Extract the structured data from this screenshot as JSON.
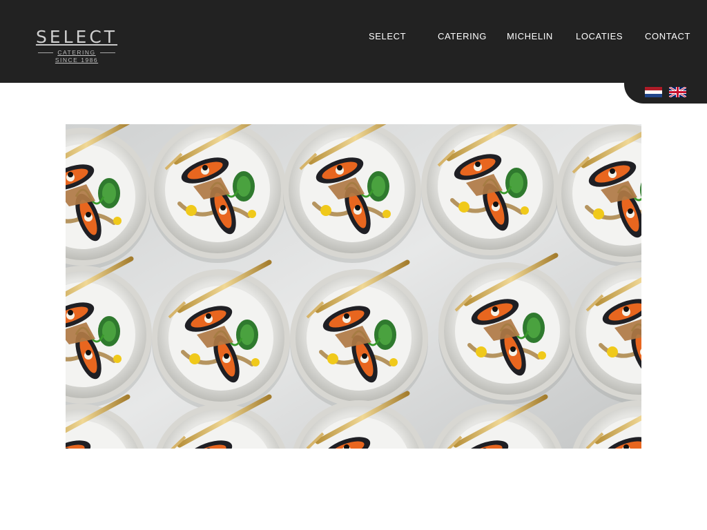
{
  "brand": {
    "name": "SELECT",
    "subtitle": "CATERING",
    "since": "SINCE 1986"
  },
  "nav": {
    "items": [
      {
        "label": "SELECT"
      },
      {
        "label": "CATERING"
      },
      {
        "label": "MICHELIN"
      },
      {
        "label": "LOCATIES"
      },
      {
        "label": "CONTACT"
      }
    ]
  },
  "languages": [
    {
      "code": "nl",
      "icon": "netherlands-flag-icon"
    },
    {
      "code": "en",
      "icon": "uk-flag-icon"
    }
  ],
  "hero": {
    "image": "plated-mussel-dishes-photo"
  },
  "colors": {
    "header_bg": "#222222",
    "nav_text": "#ffffff",
    "page_bg": "#ffffff"
  }
}
